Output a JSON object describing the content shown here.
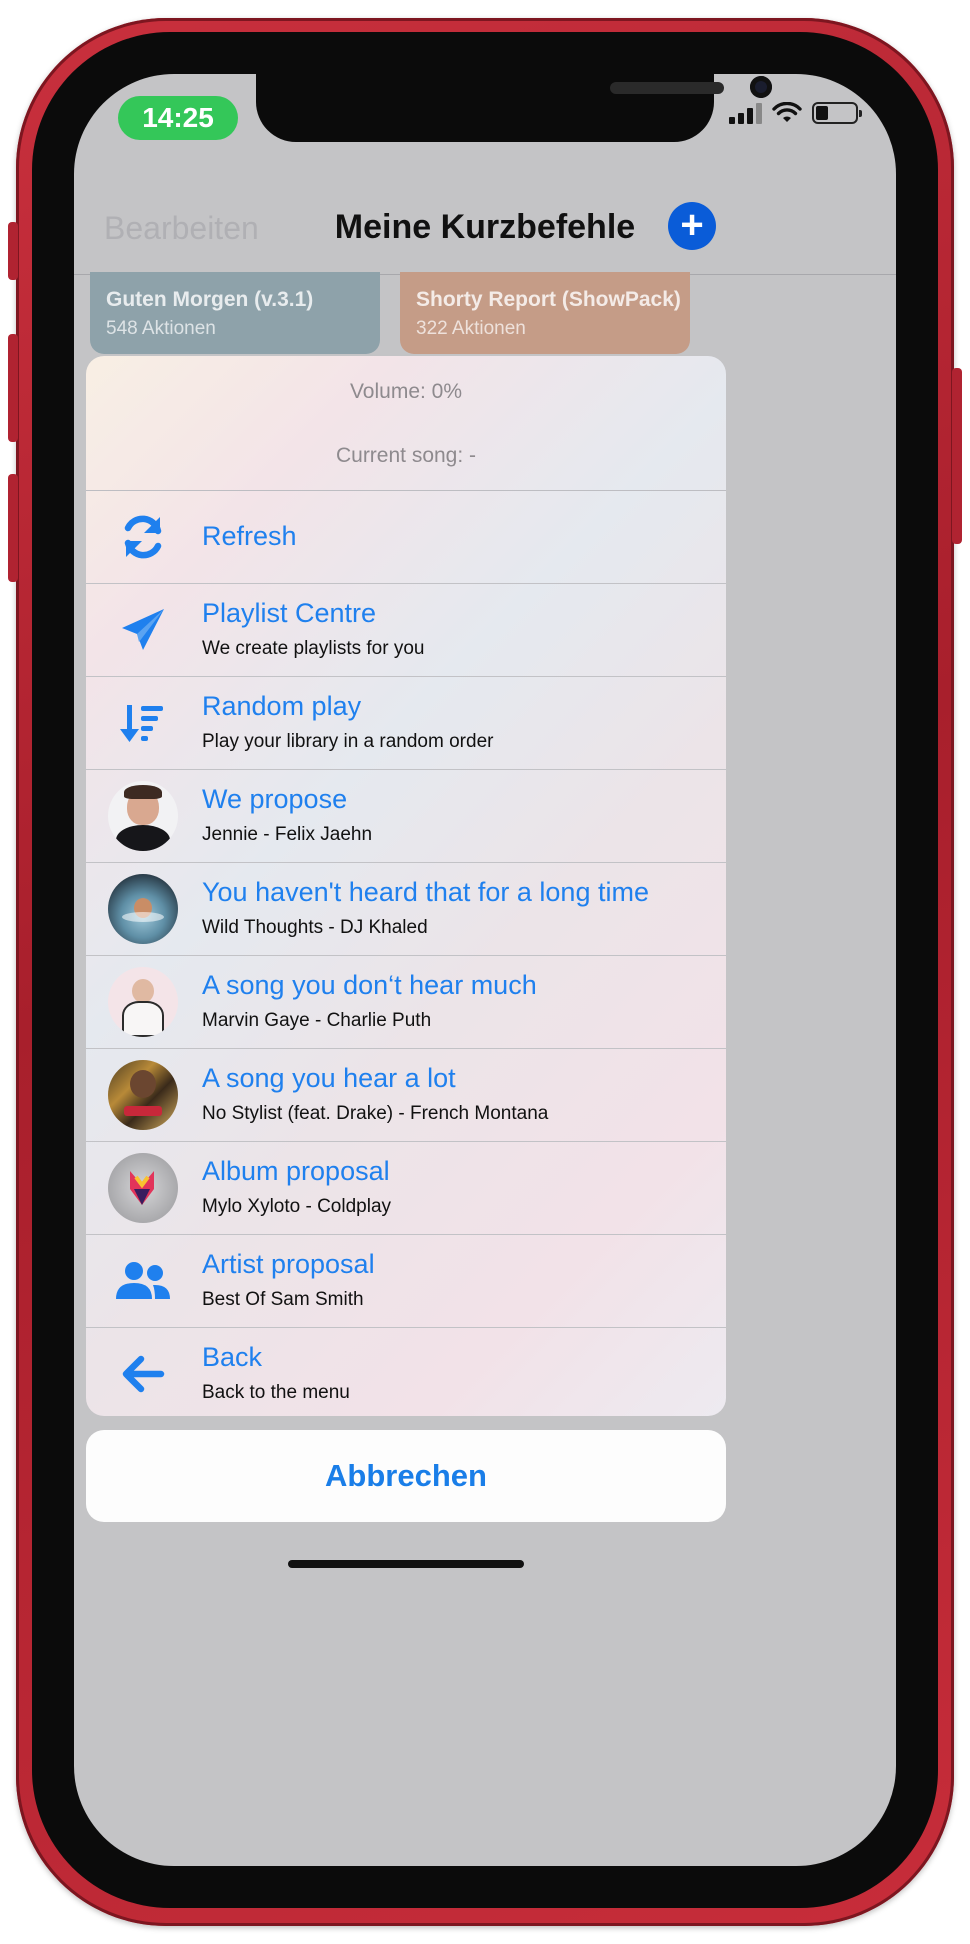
{
  "status_bar": {
    "time": "14:25"
  },
  "nav": {
    "edit_label": "Bearbeiten",
    "title": "Meine Kurzbefehle",
    "add_icon": "plus-circle-icon"
  },
  "background_cards": [
    {
      "title": "Guten Morgen (v.3.1)",
      "subtitle": "548 Aktionen",
      "color": "#8aa0a8"
    },
    {
      "title": "Shorty Report (ShowPack)",
      "subtitle": "322 Aktionen",
      "color": "#c49a85"
    }
  ],
  "sheet": {
    "volume_text": "Volume: 0%",
    "current_song_text": "Current song:  -",
    "items": [
      {
        "title": "Refresh",
        "subtitle": "",
        "icon": "refresh-icon"
      },
      {
        "title": "Playlist Centre",
        "subtitle": "We create playlists for you",
        "icon": "paper-plane-icon"
      },
      {
        "title": "Random play",
        "subtitle": "Play your library in a random order",
        "icon": "sort-descending-icon"
      },
      {
        "title": "We propose",
        "subtitle": "Jennie - Felix Jaehn",
        "icon": "artist-avatar"
      },
      {
        "title": "You haven't heard that for a long time",
        "subtitle": "Wild Thoughts  - DJ Khaled",
        "icon": "album-cover"
      },
      {
        "title": "A song you don‘t hear much",
        "subtitle": "Marvin Gaye - Charlie Puth",
        "icon": "album-cover"
      },
      {
        "title": "A song you hear a lot",
        "subtitle": "No Stylist (feat. Drake) - French Montana",
        "icon": "album-cover"
      },
      {
        "title": "Album proposal",
        "subtitle": "Mylo Xyloto - Coldplay",
        "icon": "album-cover"
      },
      {
        "title": "Artist proposal",
        "subtitle": "Best Of Sam Smith",
        "icon": "users-icon"
      },
      {
        "title": "Back",
        "subtitle": "Back to the menu",
        "icon": "arrow-left-icon"
      }
    ],
    "cancel_label": "Abbrechen"
  },
  "colors": {
    "accent": "#1f80ee",
    "phone_frame": "#c02a37",
    "time_pill": "#34c759"
  }
}
